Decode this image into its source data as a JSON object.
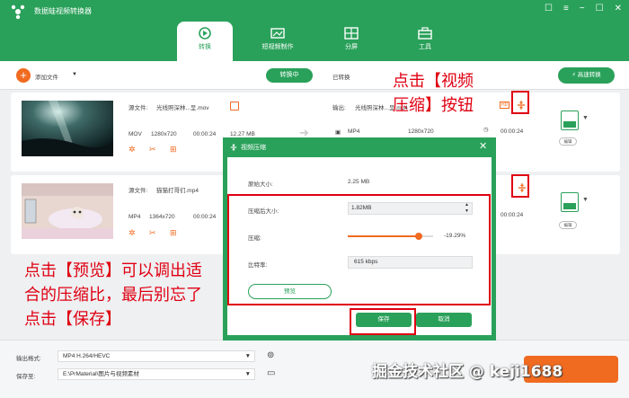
{
  "app": {
    "title": "数据蛙视频转换器",
    "accent": "#2aa15a",
    "orange": "#f06a1f",
    "annotation_red": "#e00012"
  },
  "nav_tabs": [
    {
      "label": "转换",
      "icon": "convert-icon",
      "active": true
    },
    {
      "label": "短视频制作",
      "icon": "short-video-icon",
      "active": false
    },
    {
      "label": "分屏",
      "icon": "split-screen-icon",
      "active": false
    },
    {
      "label": "工具",
      "icon": "toolbox-icon",
      "active": false
    }
  ],
  "toolbar": {
    "add_file": "添加文件",
    "converting": "转换中",
    "converted": "已转换",
    "fast_convert": "高速转换"
  },
  "files": [
    {
      "source_label": "源文件:",
      "source_name": "光线照深林...呈.mov",
      "format": "MOV",
      "resolution": "1280x720",
      "duration": "00:00:24",
      "size": "12.27 MB",
      "output_label": "输出:",
      "output_name": "光线照深林...呈.mp4",
      "out_format": "MP4",
      "out_resolution": "1280x720",
      "out_duration": "00:00:24",
      "edit_label": "编辑"
    },
    {
      "source_label": "源文件:",
      "source_name": "猫猫打哥们.mp4",
      "format": "MP4",
      "resolution": "1364x720",
      "duration": "00:00:24",
      "out_duration": "00:00:24",
      "edit_label": "编辑"
    }
  ],
  "dialog": {
    "title": "视频压缩",
    "original_size_label": "原始大小:",
    "original_size": "2.25 MB",
    "compressed_size_label": "压缩后大小:",
    "compressed_size": "1.82MB",
    "compress_label": "压缩:",
    "compress_value": "-19.29%",
    "compress_fraction": 0.83,
    "bitrate_label": "比特率:",
    "bitrate": "615 kbps",
    "preview": "预览",
    "save": "保存",
    "cancel": "取消"
  },
  "bottom": {
    "output_format_label": "输出格式:",
    "output_format": "MP4 H.264/HEVC",
    "save_to_label": "保存至:",
    "save_to": "E:\\PrMaterial\\图片与视频素材"
  },
  "annotations": {
    "top_right": [
      "点击【视频",
      "压缩】按钮"
    ],
    "left": [
      "点击【预览】可以调出适",
      "合的压缩比，最后别忘了",
      "点击【保存】"
    ]
  },
  "watermark": "掘金技术社区 @ keji1688"
}
